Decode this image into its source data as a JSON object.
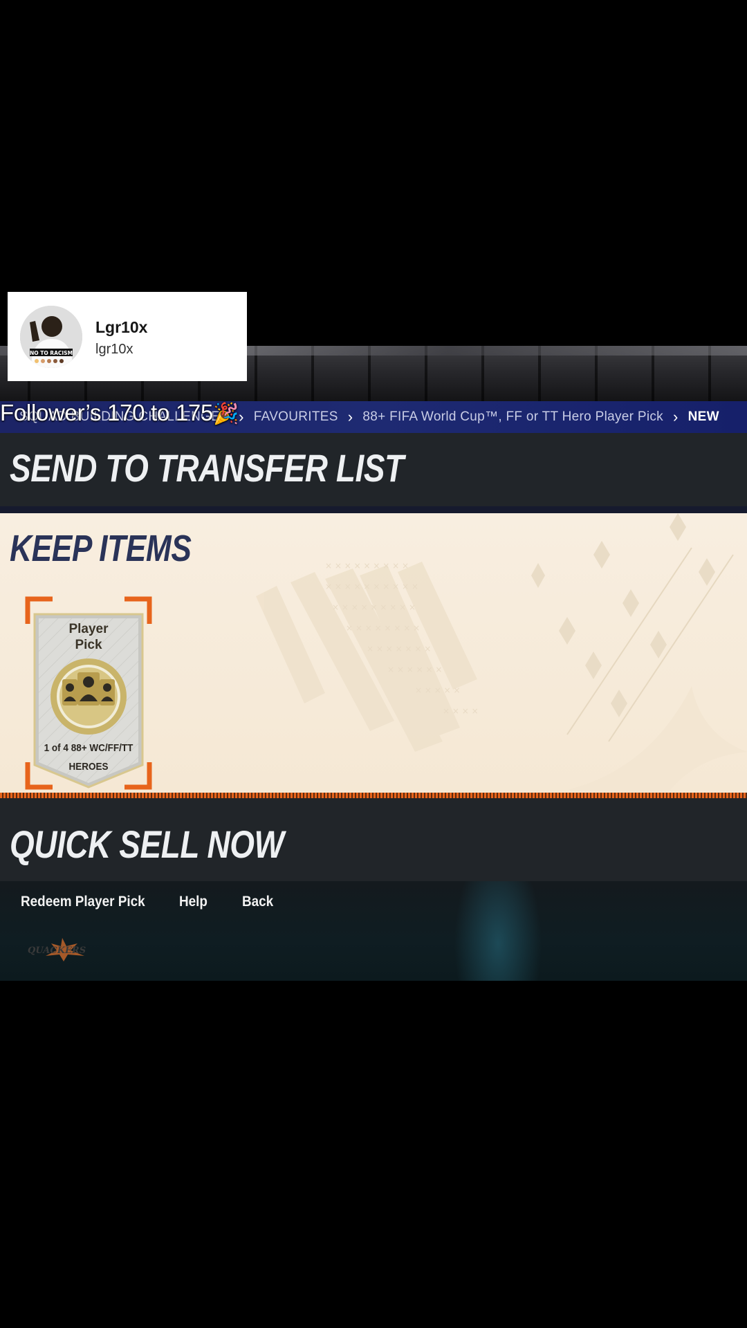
{
  "profile": {
    "display_name": "Lgr10x",
    "username": "lgr10x",
    "avatar_text": "NO TO RACISM"
  },
  "caption": {
    "text": "Follower’s 170 to 175",
    "emoji": "🎉"
  },
  "breadcrumb": {
    "items": [
      "SQUAD BUILDING CHALLENGES",
      "FAVOURITES",
      "88+ FIFA World Cup™, FF or TT Hero Player Pick",
      "NEW"
    ]
  },
  "rows": {
    "send_to_transfer_list": "SEND TO TRANSFER LIST",
    "keep_items": "KEEP ITEMS",
    "quick_sell_now": "QUICK SELL NOW"
  },
  "pick_card": {
    "title_line1": "Player",
    "title_line2": "Pick",
    "desc_line1": "1 of 4 88+ WC/FF/TT",
    "desc_line2": "HEROES"
  },
  "footer": {
    "buttons": [
      "Redeem Player Pick",
      "Help",
      "Back"
    ],
    "watermark": "QUACKERS"
  },
  "colors": {
    "breadcrumb_bg": "#1e2a72",
    "dark_row": "#212529",
    "keep_panel": "#f8eee0",
    "keep_title": "#2a3358",
    "accent_orange": "#e7641c"
  }
}
